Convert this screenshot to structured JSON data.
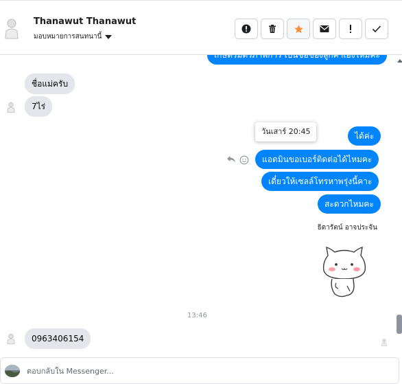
{
  "header": {
    "name": "Thanawut Thanawut",
    "assign_label": "มอบหมายการสนทนานี้",
    "buttons": [
      {
        "name": "spam-button",
        "icon": "exclamation-circle-icon"
      },
      {
        "name": "delete-button",
        "icon": "trash-icon"
      },
      {
        "name": "star-button",
        "icon": "star-icon"
      },
      {
        "name": "mark-unread-button",
        "icon": "envelope-icon"
      },
      {
        "name": "follow-up-button",
        "icon": "exclamation-icon"
      },
      {
        "name": "mark-done-button",
        "icon": "check-icon"
      }
    ],
    "star_color": "#f7923b"
  },
  "messages": {
    "top_partial": "เกษตรมิตรภาพการ เป็นชื่อของลูกค้าเองไหมคะ",
    "in_1": "ชื่อแม่ครับ",
    "in_2": "7ไร่",
    "tooltip_time": "วันเสาร์ 20:45",
    "out_1": "ได้ค่ะ",
    "out_2": "แอดมินขอเบอร์ติดต่อได้ไหมคะ",
    "out_3": "เดี๋ยวให้เซลล์โทรหาพรุ่งนี้คาะ",
    "out_4": "สะดวกไหมคะ",
    "sender_name": "ธิดารัตน์ อาจประจัน",
    "timestamp": "13:46",
    "in_3": "0963406154"
  },
  "composer": {
    "placeholder": "ตอบกลับใน Messenger..."
  },
  "colors": {
    "accent": "#0084ff",
    "incoming_bubble": "#e4e6eb"
  }
}
